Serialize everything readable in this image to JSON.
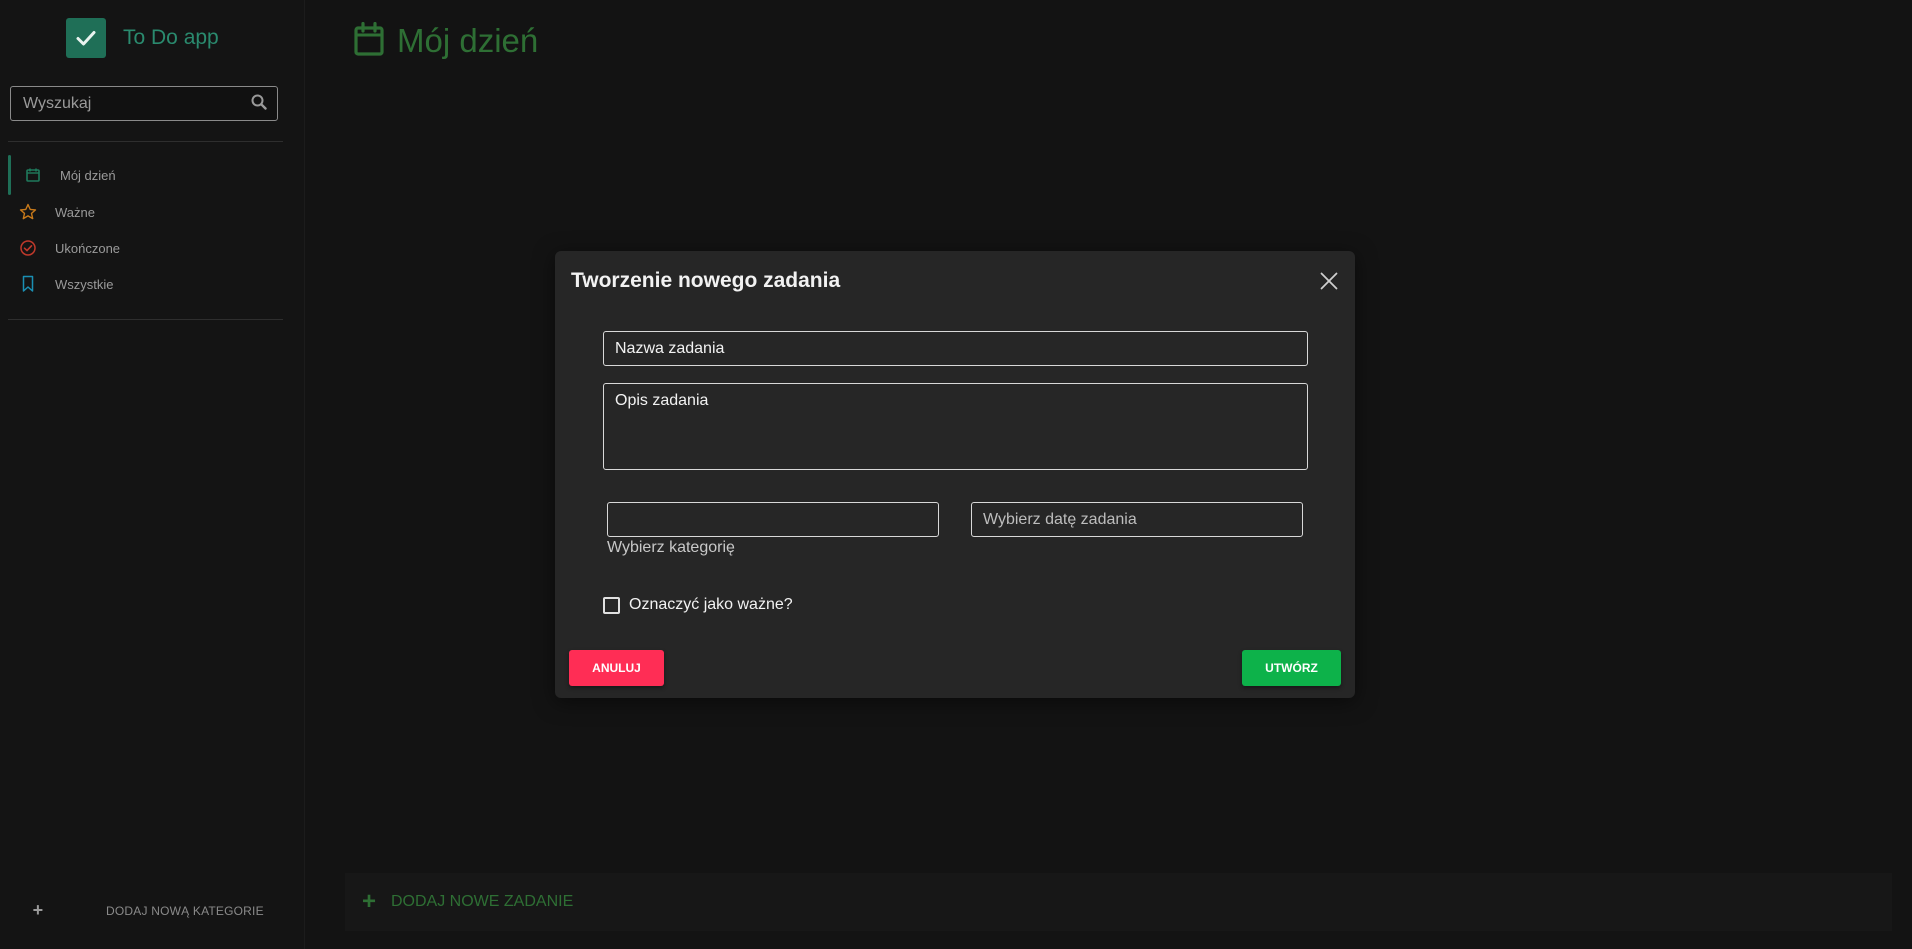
{
  "app": {
    "title": "To Do app"
  },
  "search": {
    "placeholder": "Wyszukaj"
  },
  "sidebar": {
    "items": [
      {
        "label": "Mój dzień",
        "icon": "calendar-icon",
        "color": "#1f7a5c"
      },
      {
        "label": "Ważne",
        "icon": "star-icon",
        "color": "#c97a1a"
      },
      {
        "label": "Ukończone",
        "icon": "check-circle-icon",
        "color": "#c0392b"
      },
      {
        "label": "Wszystkie",
        "icon": "bookmark-icon",
        "color": "#1a8fb3"
      }
    ],
    "add_category_label": "DODAJ NOWĄ KATEGORIE"
  },
  "main": {
    "title": "Mój dzień",
    "add_task_label": "DODAJ NOWE ZADANIE"
  },
  "modal": {
    "title": "Tworzenie nowego zadania",
    "name_placeholder": "Nazwa zadania",
    "description_placeholder": "Opis zadania",
    "category_value": "",
    "category_helper": "Wybierz kategorię",
    "date_placeholder": "Wybierz datę zadania",
    "important_label": "Oznaczyć jako ważne?",
    "important_checked": false,
    "cancel_label": "ANULUJ",
    "create_label": "UTWÓRZ"
  },
  "colors": {
    "accent_green": "#2e6f34",
    "logo_teal": "#1f6f57",
    "cancel_red": "#ff2d55",
    "create_green": "#0db24a"
  }
}
